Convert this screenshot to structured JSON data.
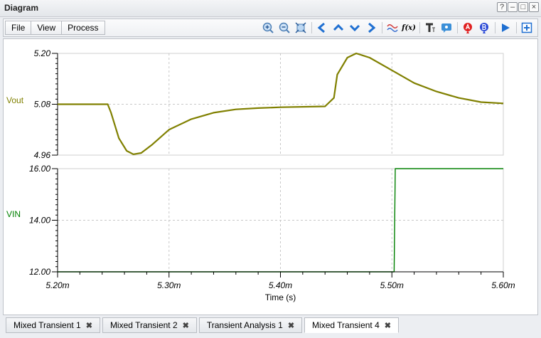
{
  "window": {
    "title": "Diagram",
    "buttons": [
      "?",
      "–",
      "□",
      "×"
    ]
  },
  "menu": {
    "items": [
      "File",
      "View",
      "Process"
    ]
  },
  "toolbar": {
    "icons": [
      "zoom-in-icon",
      "zoom-out-icon",
      "fit-icon",
      "arrow-left-icon",
      "arrow-up-icon",
      "arrow-down-icon",
      "arrow-right-icon",
      "waveform-icon",
      "fx-icon",
      "text-icon",
      "comment-icon",
      "cursor-a-icon",
      "cursor-b-icon",
      "play-icon",
      "export-icon"
    ],
    "fx_label": "f(x)"
  },
  "chart_data": [
    {
      "type": "line",
      "series": [
        {
          "name": "Vout",
          "color": "#808000",
          "x": [
            5.2,
            5.245,
            5.248,
            5.255,
            5.262,
            5.268,
            5.275,
            5.285,
            5.3,
            5.32,
            5.34,
            5.36,
            5.38,
            5.4,
            5.44,
            5.448,
            5.451,
            5.46,
            5.468,
            5.48,
            5.5,
            5.52,
            5.54,
            5.56,
            5.58,
            5.6
          ],
          "y": [
            5.08,
            5.08,
            5.06,
            5.0,
            4.97,
            4.962,
            4.965,
            4.985,
            5.02,
            5.045,
            5.06,
            5.068,
            5.071,
            5.073,
            5.075,
            5.095,
            5.15,
            5.19,
            5.2,
            5.19,
            5.16,
            5.13,
            5.11,
            5.095,
            5.085,
            5.082
          ]
        }
      ],
      "ylabel": "Vout",
      "ylim": [
        4.96,
        5.2
      ],
      "yticks": [
        "4.96",
        "5.08",
        "5.20"
      ],
      "xlim": [
        5.2,
        5.6
      ],
      "grid": true
    },
    {
      "type": "line",
      "series": [
        {
          "name": "VIN",
          "color": "#008000",
          "x": [
            5.2,
            5.502,
            5.503,
            5.6
          ],
          "y": [
            12.0,
            12.0,
            16.0,
            16.0
          ]
        }
      ],
      "ylabel": "VIN",
      "ylim": [
        12.0,
        16.0
      ],
      "yticks": [
        "12.00",
        "14.00",
        "16.00"
      ],
      "xlim": [
        5.2,
        5.6
      ],
      "grid": true,
      "xticks": [
        "5.20m",
        "5.30m",
        "5.40m",
        "5.50m",
        "5.60m"
      ],
      "xlabel": "Time (s)"
    }
  ],
  "tabs": [
    {
      "label": "Mixed Transient 1",
      "active": false
    },
    {
      "label": "Mixed Transient 2",
      "active": false
    },
    {
      "label": "Transient Analysis 1",
      "active": false
    },
    {
      "label": "Mixed Transient 4",
      "active": true
    }
  ],
  "close_glyph": "✖"
}
